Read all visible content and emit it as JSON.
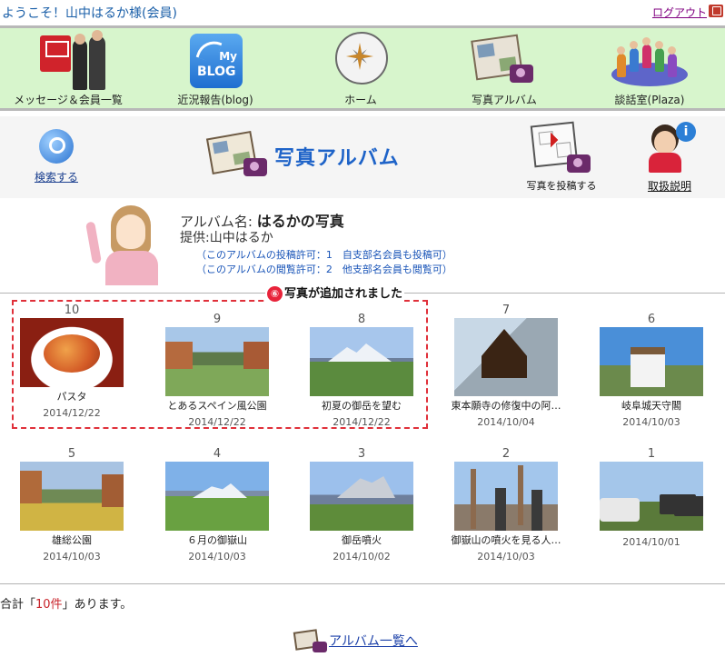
{
  "header": {
    "welcome": "ようこそ！山中はるか様(会員)",
    "logout": "ログアウト"
  },
  "nav": {
    "items": [
      {
        "label": "メッセージ＆会員一覧",
        "icon": "members-message-icon"
      },
      {
        "label": "近況報告(blog)",
        "icon": "blog-icon",
        "icon_text": [
          "My",
          "BLOG"
        ]
      },
      {
        "label": "ホーム",
        "icon": "compass-home-icon"
      },
      {
        "label": "写真アルバム",
        "icon": "photo-album-icon"
      },
      {
        "label": "談話室(Plaza)",
        "icon": "plaza-people-icon"
      }
    ]
  },
  "banner": {
    "search_label": "検索する",
    "title": "写真アルバム",
    "post_label": "写真を投稿する",
    "help_label": "取扱説明",
    "help_icon_glyph": "i"
  },
  "album": {
    "name_label": "アルバム名:",
    "name_value": "はるかの写真",
    "provider": "提供:山中はるか",
    "permission_post": "（このアルバムの投稿許可：1　自支部名会員も投稿可）",
    "permission_view": "（このアルバムの閲覧許可：2　他支部名会員も閲覧可）"
  },
  "notice": {
    "badge": "⑥",
    "text": "写真が追加されました"
  },
  "photos": [
    {
      "num": "10",
      "caption": "パスタ",
      "date": "2014/12/22",
      "style": "pasta"
    },
    {
      "num": "9",
      "caption": "とあるスペイン風公園",
      "date": "2014/12/22",
      "style": "garden"
    },
    {
      "num": "8",
      "caption": "初夏の御岳を望む",
      "date": "2014/12/22",
      "style": "mount"
    },
    {
      "num": "7",
      "caption": "東本願寺の修復中の阿…",
      "date": "2014/10/04",
      "style": "temple"
    },
    {
      "num": "6",
      "caption": "岐阜城天守閣",
      "date": "2014/10/03",
      "style": "castle"
    },
    {
      "num": "5",
      "caption": "雄総公園",
      "date": "2014/10/03",
      "style": "valley"
    },
    {
      "num": "4",
      "caption": "６月の御嶽山",
      "date": "2014/10/03",
      "style": "june"
    },
    {
      "num": "3",
      "caption": "御岳噴火",
      "date": "2014/10/02",
      "style": "ontake"
    },
    {
      "num": "2",
      "caption": "御嶽山の噴火を見る人…",
      "date": "2014/10/03",
      "style": "erupt"
    },
    {
      "num": "1",
      "caption": "",
      "date": "2014/10/01",
      "style": "crowd"
    }
  ],
  "summary": {
    "prefix": "合計「",
    "count": "10件",
    "suffix": "」あります。"
  },
  "footer": {
    "album_list_link": "アルバム一覧へ"
  },
  "colors": {
    "nav_bg": "#d7f5cc",
    "title_blue": "#1e63c8",
    "notice_red": "#e0303a"
  }
}
